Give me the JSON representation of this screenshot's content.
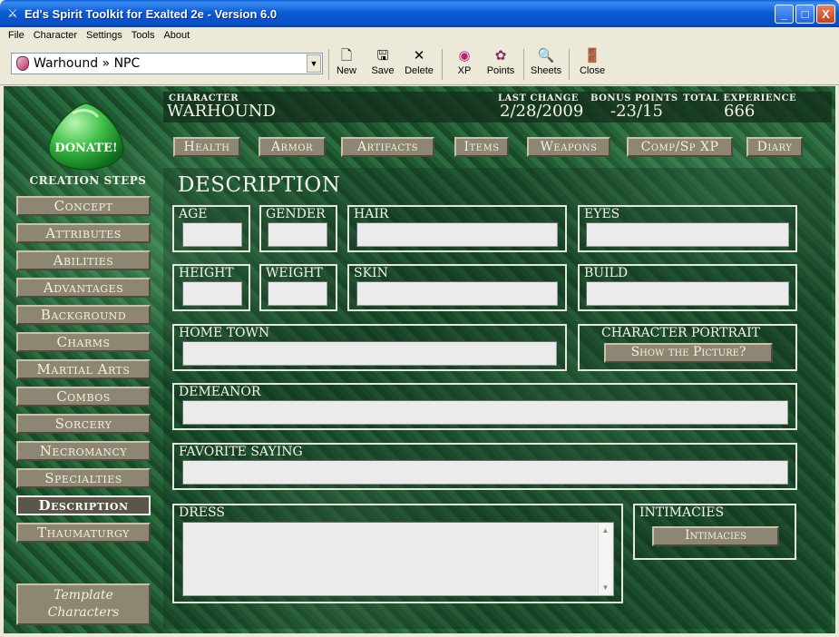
{
  "window": {
    "title": "Ed's Spirit Toolkit for Exalted 2e - Version 6.0",
    "buttons": [
      "_",
      "□",
      "X"
    ]
  },
  "menu": [
    "File",
    "Character",
    "Settings",
    "Tools",
    "About"
  ],
  "toolbar": {
    "character_select": "Warhound » NPC",
    "buttons": [
      {
        "label": "New",
        "icon": "new-document-icon"
      },
      {
        "label": "Save",
        "icon": "floppy-disk-icon"
      },
      {
        "label": "Delete",
        "icon": "x-delete-icon"
      },
      {
        "label": "XP",
        "icon": "xp-orb-icon"
      },
      {
        "label": "Points",
        "icon": "points-icon"
      },
      {
        "label": "Sheets",
        "icon": "sheets-icon"
      },
      {
        "label": "Close",
        "icon": "door-exit-icon"
      }
    ]
  },
  "sidebar": {
    "donate_label": "DONATE!",
    "creation_steps_title": "CREATION STEPS",
    "steps": [
      "Concept",
      "Attributes",
      "Abilities",
      "Advantages",
      "Background",
      "Charms",
      "Martial Arts",
      "Combos",
      "Sorcery",
      "Necromancy",
      "Specialties",
      "Description",
      "Thaumaturgy"
    ],
    "active_step": "Description",
    "template_line1": "Template",
    "template_line2": "Characters"
  },
  "header": {
    "character_label": "CHARACTER",
    "character_name": "WARHOUND",
    "last_change_label": "LAST CHANGE",
    "last_change": "2/28/2009",
    "bonus_points_label": "BONUS POINTS",
    "bonus_points": "-23/15",
    "total_xp_label": "TOTAL EXPERIENCE",
    "total_xp": "666"
  },
  "tabs": [
    "Health",
    "Armor",
    "Artifacts",
    "Items",
    "Weapons",
    "Comp/Sp XP",
    "Diary"
  ],
  "description": {
    "title": "DESCRIPTION",
    "age_label": "AGE",
    "age": "",
    "gender_label": "GENDER",
    "gender": "",
    "hair_label": "HAIR",
    "hair": "",
    "eyes_label": "EYES",
    "eyes": "",
    "height_label": "HEIGHT",
    "height": "",
    "weight_label": "WEIGHT",
    "weight": "",
    "skin_label": "SKIN",
    "skin": "",
    "build_label": "BUILD",
    "build": "",
    "hometown_label": "HOME TOWN",
    "hometown": "",
    "portrait_label": "CHARACTER PORTRAIT",
    "portrait_button": "Show the Picture?",
    "demeanor_label": "DEMEANOR",
    "demeanor": "",
    "saying_label": "FAVORITE SAYING",
    "saying": "",
    "dress_label": "DRESS",
    "dress": "",
    "intimacies_label": "INTIMACIES",
    "intimacies_button": "Intimacies"
  }
}
